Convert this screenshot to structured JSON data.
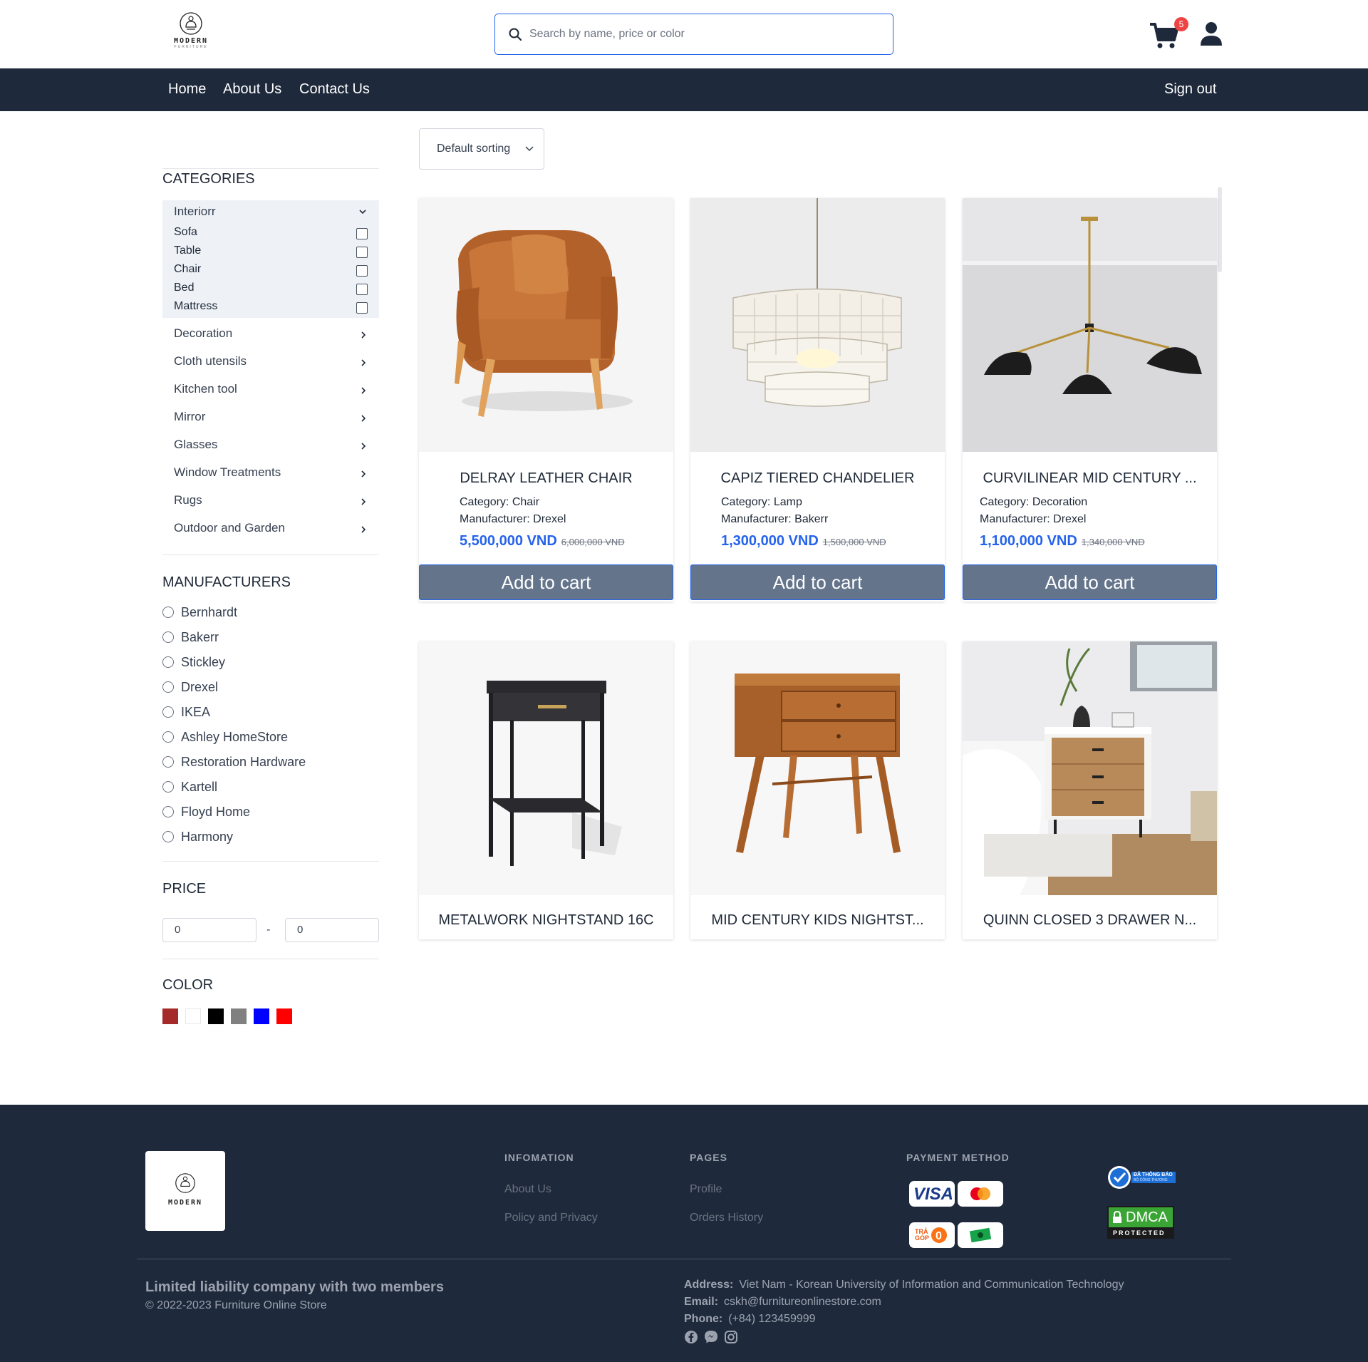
{
  "header": {
    "logo_word": "MODERN",
    "logo_sub": "FURNITURE",
    "search_placeholder": "Search by name, price or color",
    "cart_count": "5"
  },
  "nav": {
    "home": "Home",
    "about": "About Us",
    "contact": "Contact Us",
    "signout": "Sign out"
  },
  "sidebar": {
    "categories_title": "CATEGORIES",
    "open_category": "Interiorr",
    "sub_items": [
      "Sofa",
      "Table",
      "Chair",
      "Bed",
      "Mattress"
    ],
    "categories": [
      "Decoration",
      "Cloth utensils",
      "Kitchen tool",
      "Mirror",
      "Glasses",
      "Window Treatments",
      "Rugs",
      "Outdoor and Garden"
    ],
    "manufacturers_title": "MANUFACTURERS",
    "manufacturers": [
      "Bernhardt",
      "Bakerr",
      "Stickley",
      "Drexel",
      "IKEA",
      "Ashley HomeStore",
      "Restoration Hardware",
      "Kartell",
      "Floyd Home",
      "Harmony"
    ],
    "price_title": "PRICE",
    "price_min": "0",
    "price_max": "0",
    "price_dash": "-",
    "color_title": "COLOR",
    "colors": [
      "#a52a2a",
      "#ffffff",
      "#000000",
      "#808080",
      "#0000ff",
      "#ff0000"
    ]
  },
  "sort": {
    "label": "Default sorting"
  },
  "products": [
    {
      "name": "DELRAY LEATHER CHAIR",
      "category_label": "Category: ",
      "category": "Chair",
      "manufacturer_label": "Manufacturer: ",
      "manufacturer": "Drexel",
      "price": "5,500,000 VND",
      "old_price": "6,000,000 VND",
      "button": "Add to cart",
      "icon": "armchair-image"
    },
    {
      "name": "CAPIZ TIERED CHANDELIER",
      "category_label": "Category: ",
      "category": "Lamp",
      "manufacturer_label": "Manufacturer: ",
      "manufacturer": "Bakerr",
      "price": "1,300,000 VND",
      "old_price": "1,500,000 VND",
      "button": "Add to cart",
      "icon": "chandelier-image"
    },
    {
      "name": "CURVILINEAR MID CENTURY ...",
      "category_label": "Category: ",
      "category": "Decoration",
      "manufacturer_label": "Manufacturer: ",
      "manufacturer": "Drexel",
      "price": "1,100,000 VND",
      "old_price": "1,340,000 VND",
      "button": "Add to cart",
      "icon": "pendant-lamp-image"
    },
    {
      "name": "METALWORK NIGHTSTAND 16C",
      "icon": "metal-nightstand-image"
    },
    {
      "name": "MID CENTURY KIDS NIGHTST...",
      "icon": "wood-nightstand-image"
    },
    {
      "name": "QUINN CLOSED 3 DRAWER N...",
      "icon": "drawer-nightstand-image"
    }
  ],
  "footer": {
    "logo_word": "MODERN",
    "info_title": "INFOMATION",
    "info_links": [
      "About Us",
      "Policy and Privacy"
    ],
    "pages_title": "PAGES",
    "pages_links": [
      "Profile",
      "Orders History"
    ],
    "payment_title": "PAYMENT METHOD",
    "payment_visa": "VISA",
    "payment_installment": "TRẢ GÓP",
    "cert_bct": "ĐÃ THÔNG BÁO",
    "cert_bct_sub": "BỘ CÔNG THƯƠNG",
    "cert_dmca": "DMCA",
    "cert_dmca_sub": "PROTECTED",
    "company": "Limited liability company with two members",
    "copyright": "© 2022-2023 Furniture Online Store",
    "address_label": "Address:",
    "address": "Viet Nam - Korean University of Information and Communication Technology",
    "email_label": "Email:",
    "email": "cskh@furnitureonlinestore.com",
    "phone_label": "Phone:",
    "phone": "(+84) 123459999"
  }
}
